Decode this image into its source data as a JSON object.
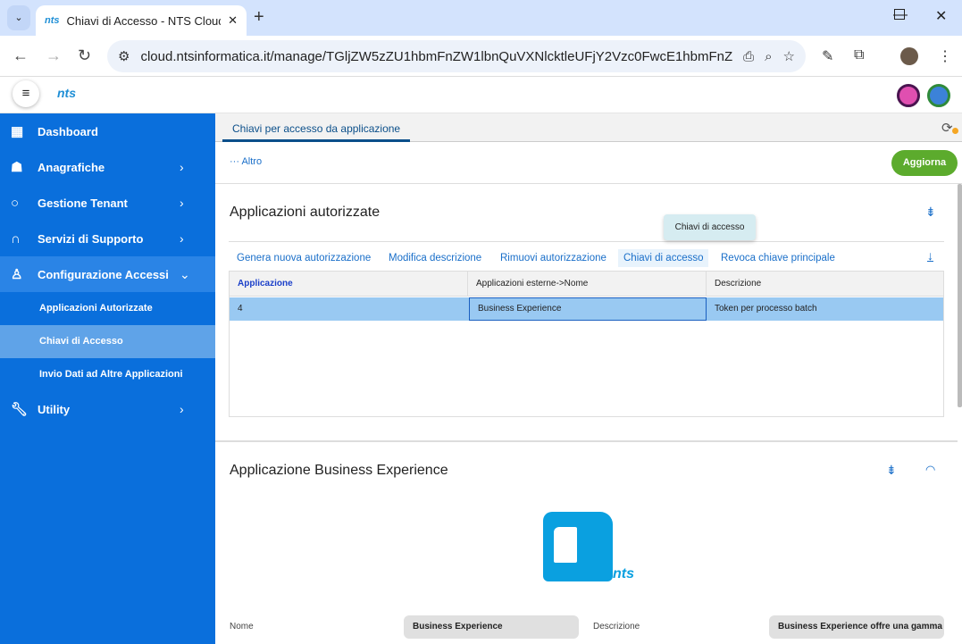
{
  "browser": {
    "tab_title": "Chiavi di Accesso - NTS Cloud T",
    "favicon_text": "nts",
    "url": "cloud.ntsinformatica.it/manage/TGljZW5zZU1hbmFnZW1lbnQuVXNlcktleUFjY2Vzc0FwcE1hbmFnZXJ..."
  },
  "app": {
    "logo_text": "nts",
    "sidebar": {
      "items": [
        {
          "label": "Dashboard",
          "icon": "grid-icon"
        },
        {
          "label": "Anagrafiche",
          "icon": "people-icon"
        },
        {
          "label": "Gestione Tenant",
          "icon": "bulb-icon"
        },
        {
          "label": "Servizi di Supporto",
          "icon": "headset-icon"
        },
        {
          "label": "Configurazione Accessi",
          "icon": "user-gear-icon"
        },
        {
          "label": "Utility",
          "icon": "wrench-icon"
        }
      ],
      "subitems": [
        "Applicazioni Autorizzate",
        "Chiavi di Accesso",
        "Invio Dati ad Altre Applicazioni"
      ]
    },
    "page_tab": "Chiavi per accesso da applicazione",
    "toolbar": {
      "more": "··· Altro",
      "refresh": "Aggiorna"
    },
    "section1": {
      "title": "Applicazioni autorizzate",
      "actions": [
        "Genera nuova autorizzazione",
        "Modifica descrizione",
        "Rimuovi autorizzazione",
        "Chiavi di accesso",
        "Revoca chiave principale"
      ],
      "tooltip": "Chiavi di accesso",
      "columns": [
        "Applicazione",
        "Applicazioni esterne->Nome",
        "Descrizione"
      ],
      "rows": [
        [
          "4",
          "Business Experience",
          "Token per processo batch"
        ]
      ]
    },
    "section2": {
      "title": "Applicazione Business Experience",
      "logo_text": "nts",
      "name_label": "Nome",
      "name_value": "Business Experience",
      "desc_label": "Descrizione",
      "desc_value": "Business Experience offre una gamma"
    }
  },
  "colors": {
    "sidebar": "#0a6fdc",
    "accent": "#1a6fc9",
    "refresh": "#5cab2d",
    "selected_row": "#99c9f2"
  }
}
